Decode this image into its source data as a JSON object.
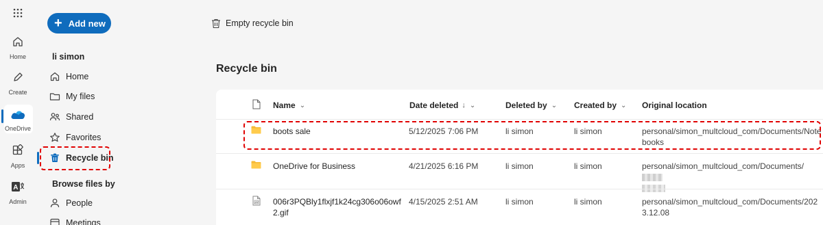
{
  "rail": {
    "items": [
      {
        "label": "Home",
        "icon": "home-icon"
      },
      {
        "label": "Create",
        "icon": "pen-icon"
      },
      {
        "label": "OneDrive",
        "icon": "onedrive-cloud-icon"
      },
      {
        "label": "Apps",
        "icon": "apps-icon"
      },
      {
        "label": "Admin",
        "icon": "admin-icon"
      }
    ]
  },
  "nav": {
    "add_new": "Add new",
    "user_heading": "li simon",
    "items": [
      {
        "label": "Home",
        "icon": "home-icon"
      },
      {
        "label": "My files",
        "icon": "folder-icon"
      },
      {
        "label": "Shared",
        "icon": "people-icon"
      },
      {
        "label": "Favorites",
        "icon": "star-icon"
      },
      {
        "label": "Recycle bin",
        "icon": "trash-icon"
      }
    ],
    "browse_heading": "Browse files by",
    "browse_items": [
      {
        "label": "People",
        "icon": "person-icon"
      },
      {
        "label": "Meetings",
        "icon": "calendar-icon"
      }
    ]
  },
  "command_bar": {
    "empty_recycle_bin": "Empty recycle bin"
  },
  "page": {
    "title": "Recycle bin"
  },
  "table": {
    "columns": {
      "name": "Name",
      "date_deleted": "Date deleted",
      "deleted_by": "Deleted by",
      "created_by": "Created by",
      "original_location": "Original location"
    },
    "rows": [
      {
        "type": "folder",
        "name": "boots sale",
        "date_deleted": "5/12/2025 7:06 PM",
        "deleted_by": "li simon",
        "created_by": "li simon",
        "location": "personal/simon_multcloud_com/Documents/Notebooks"
      },
      {
        "type": "folder",
        "name": "OneDrive for Business",
        "date_deleted": "4/21/2025 6:16 PM",
        "deleted_by": "li simon",
        "created_by": "li simon",
        "location": "personal/simon_multcloud_com/Documents/"
      },
      {
        "type": "image",
        "name": "006r3PQBly1flxjf1k24cg306o06owf2.gif",
        "date_deleted": "4/15/2025 2:51 AM",
        "deleted_by": "li simon",
        "created_by": "li simon",
        "location": "personal/simon_multcloud_com/Documents/2023.12.08"
      }
    ]
  },
  "colors": {
    "accent": "#0f6cbd",
    "highlight_dash": "#e00000",
    "folder": "#f5b936"
  }
}
